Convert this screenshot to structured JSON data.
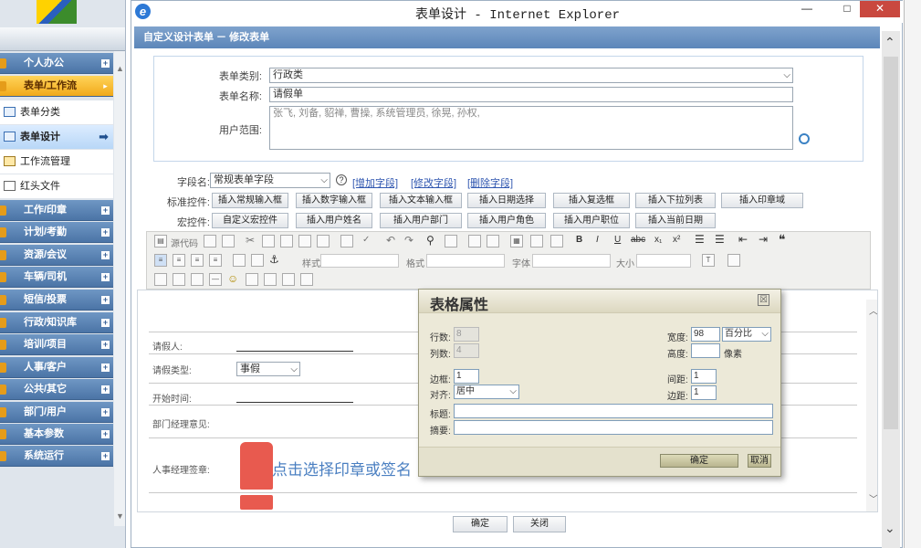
{
  "window": {
    "title": "表单设计 - Internet Explorer",
    "minimize": "—",
    "maximize": "□",
    "close": "✕"
  },
  "sidebar": {
    "menus": [
      {
        "label": "个人办公"
      },
      {
        "label": "表单/工作流",
        "active": true
      },
      {
        "label": "工作/印章"
      },
      {
        "label": "计划/考勤"
      },
      {
        "label": "资源/会议"
      },
      {
        "label": "车辆/司机"
      },
      {
        "label": "短信/投票"
      },
      {
        "label": "行政/知识库"
      },
      {
        "label": "培训/项目"
      },
      {
        "label": "人事/客户"
      },
      {
        "label": "公共/其它"
      },
      {
        "label": "部门/用户"
      },
      {
        "label": "基本参数"
      },
      {
        "label": "系统运行"
      }
    ],
    "submenu": [
      {
        "label": "表单分类"
      },
      {
        "label": "表单设计",
        "selected": true
      },
      {
        "label": "工作流管理"
      },
      {
        "label": "红头文件"
      }
    ]
  },
  "breadcrumb": "自定义设计表单 － 修改表单",
  "form": {
    "category_label": "表单类别:",
    "category_value": "行政类",
    "name_label": "表单名称:",
    "name_value": "请假单",
    "scope_label": "用户范围:",
    "scope_value": "张飞, 刘备, 貂禅, 曹操, 系统管理员, 徐晃, 孙权,"
  },
  "fields": {
    "field_name_label": "字段名:",
    "field_name_value": "常规表单字段",
    "help": "?",
    "add_link": "[增加字段]",
    "edit_link": "[修改字段]",
    "delete_link": "[删除字段]",
    "standard_label": "标准控件:",
    "standard_buttons": [
      "插入常规输入框",
      "插入数字输入框",
      "插入文本输入框",
      "插入日期选择",
      "插入复选框",
      "插入下拉列表",
      "插入印章域"
    ],
    "macro_label": "宏控件:",
    "macro_buttons": [
      "自定义宏控件",
      "插入用户姓名",
      "插入用户部门",
      "插入用户角色",
      "插入用户职位",
      "插入当前日期"
    ]
  },
  "editor_toolbar": {
    "source": "源代码",
    "style": "样式",
    "format": "格式",
    "font": "字体",
    "size": "大小"
  },
  "table": {
    "rows": [
      {
        "label": "请假人:"
      },
      {
        "label": "请假类型:",
        "select_value": "事假"
      },
      {
        "label": "开始时间:"
      },
      {
        "label": "部门经理意见:"
      },
      {
        "label": "人事经理签章:",
        "stamp_text": "点击选择印章或签名"
      }
    ]
  },
  "dialog": {
    "title": "表格属性",
    "close": "☒",
    "rows_label": "行数:",
    "rows_value": "8",
    "cols_label": "列数:",
    "cols_value": "4",
    "width_label": "宽度:",
    "width_value": "98",
    "width_unit": "百分比",
    "height_label": "高度:",
    "height_unit": "像素",
    "border_label": "边框:",
    "border_value": "1",
    "spacing_label": "间距:",
    "spacing_value": "1",
    "align_label": "对齐:",
    "align_value": "居中",
    "padding_label": "边距:",
    "padding_value": "1",
    "caption_label": "标题:",
    "summary_label": "摘要:",
    "ok": "确定",
    "cancel": "取消"
  },
  "page_buttons": {
    "ok": "确定",
    "close": "关闭"
  }
}
